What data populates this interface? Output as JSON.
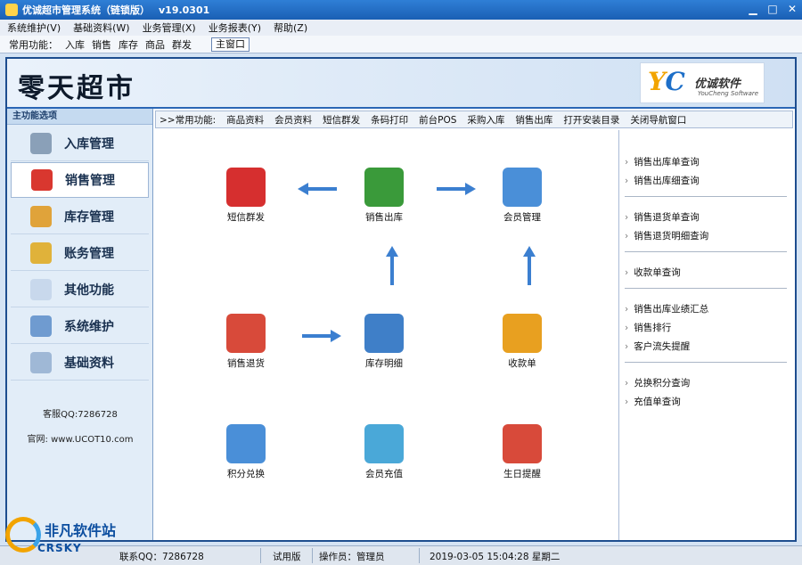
{
  "window": {
    "title": "优诚超市管理系统（链锁版）",
    "version": "v19.0301"
  },
  "menu": [
    "系统维护(V)",
    "基础资料(W)",
    "业务管理(X)",
    "业务报表(Y)",
    "帮助(Z)"
  ],
  "quickbar": {
    "label": "常用功能：",
    "items": [
      "入库",
      "销售",
      "库存",
      "商品",
      "群发"
    ],
    "main_window": "主窗口"
  },
  "banner": {
    "store_name": "零天超市",
    "logo_cn": "优诚软件",
    "logo_en": "YouCheng Software",
    "logo_mark": "YC"
  },
  "sidebar": {
    "header": "主功能选项",
    "items": [
      {
        "label": "入库管理",
        "color": "#8aa0b8"
      },
      {
        "label": "销售管理",
        "color": "#d9372f"
      },
      {
        "label": "库存管理",
        "color": "#e0a33a"
      },
      {
        "label": "账务管理",
        "color": "#e0b23a"
      },
      {
        "label": "其他功能",
        "color": "#c8d8ec"
      },
      {
        "label": "系统维护",
        "color": "#6f9bd0"
      },
      {
        "label": "基础资料",
        "color": "#9fb8d6"
      }
    ],
    "active_index": 1,
    "qq": "客服QQ:7286728",
    "website": "官网: www.UCOT10.com"
  },
  "toolbar2": {
    "prefix": ">>常用功能:",
    "items": [
      "商品资料",
      "会员资料",
      "短信群发",
      "条码打印",
      "前台POS",
      "采购入库",
      "销售出库",
      "打开安装目录",
      "关闭导航窗口"
    ]
  },
  "flow": {
    "nodes": [
      {
        "label": "短信群发",
        "icon": "mailbox-icon",
        "color": "#d62f2f"
      },
      {
        "label": "销售出库",
        "icon": "cart-out-icon",
        "color": "#3a9a3a"
      },
      {
        "label": "会员管理",
        "icon": "members-icon",
        "color": "#4a8fd8"
      },
      {
        "label": "销售退货",
        "icon": "cart-return-icon",
        "color": "#d84a3a"
      },
      {
        "label": "库存明细",
        "icon": "warehouse-icon",
        "color": "#3f7fc8"
      },
      {
        "label": "收款单",
        "icon": "receipt-icon",
        "color": "#e8a020"
      },
      {
        "label": "积分兑换",
        "icon": "gift-icon",
        "color": "#4a8fd8"
      },
      {
        "label": "会员充值",
        "icon": "vip-card-icon",
        "color": "#4aa8d8"
      },
      {
        "label": "生日提醒",
        "icon": "birthday-icon",
        "color": "#d84a3a"
      }
    ],
    "arrow_color": "#3b7fd0"
  },
  "rightpanel": {
    "groups": [
      [
        "销售出库单查询",
        "销售出库细查询"
      ],
      [
        "销售退货单查询",
        "销售退货明细查询"
      ],
      [
        "收款单查询"
      ],
      [
        "销售出库业绩汇总",
        "销售排行",
        "客户流失提醒"
      ],
      [
        "兑换积分查询",
        "充值单查询"
      ]
    ]
  },
  "statusbar": {
    "qq": "联系QQ：7286728",
    "edition": "试用版",
    "operator": "操作员：管理员",
    "datetime": "2019-03-05  15:04:28 星期二"
  },
  "watermark": {
    "cn": "非凡软件站",
    "en": "CRSKY"
  }
}
